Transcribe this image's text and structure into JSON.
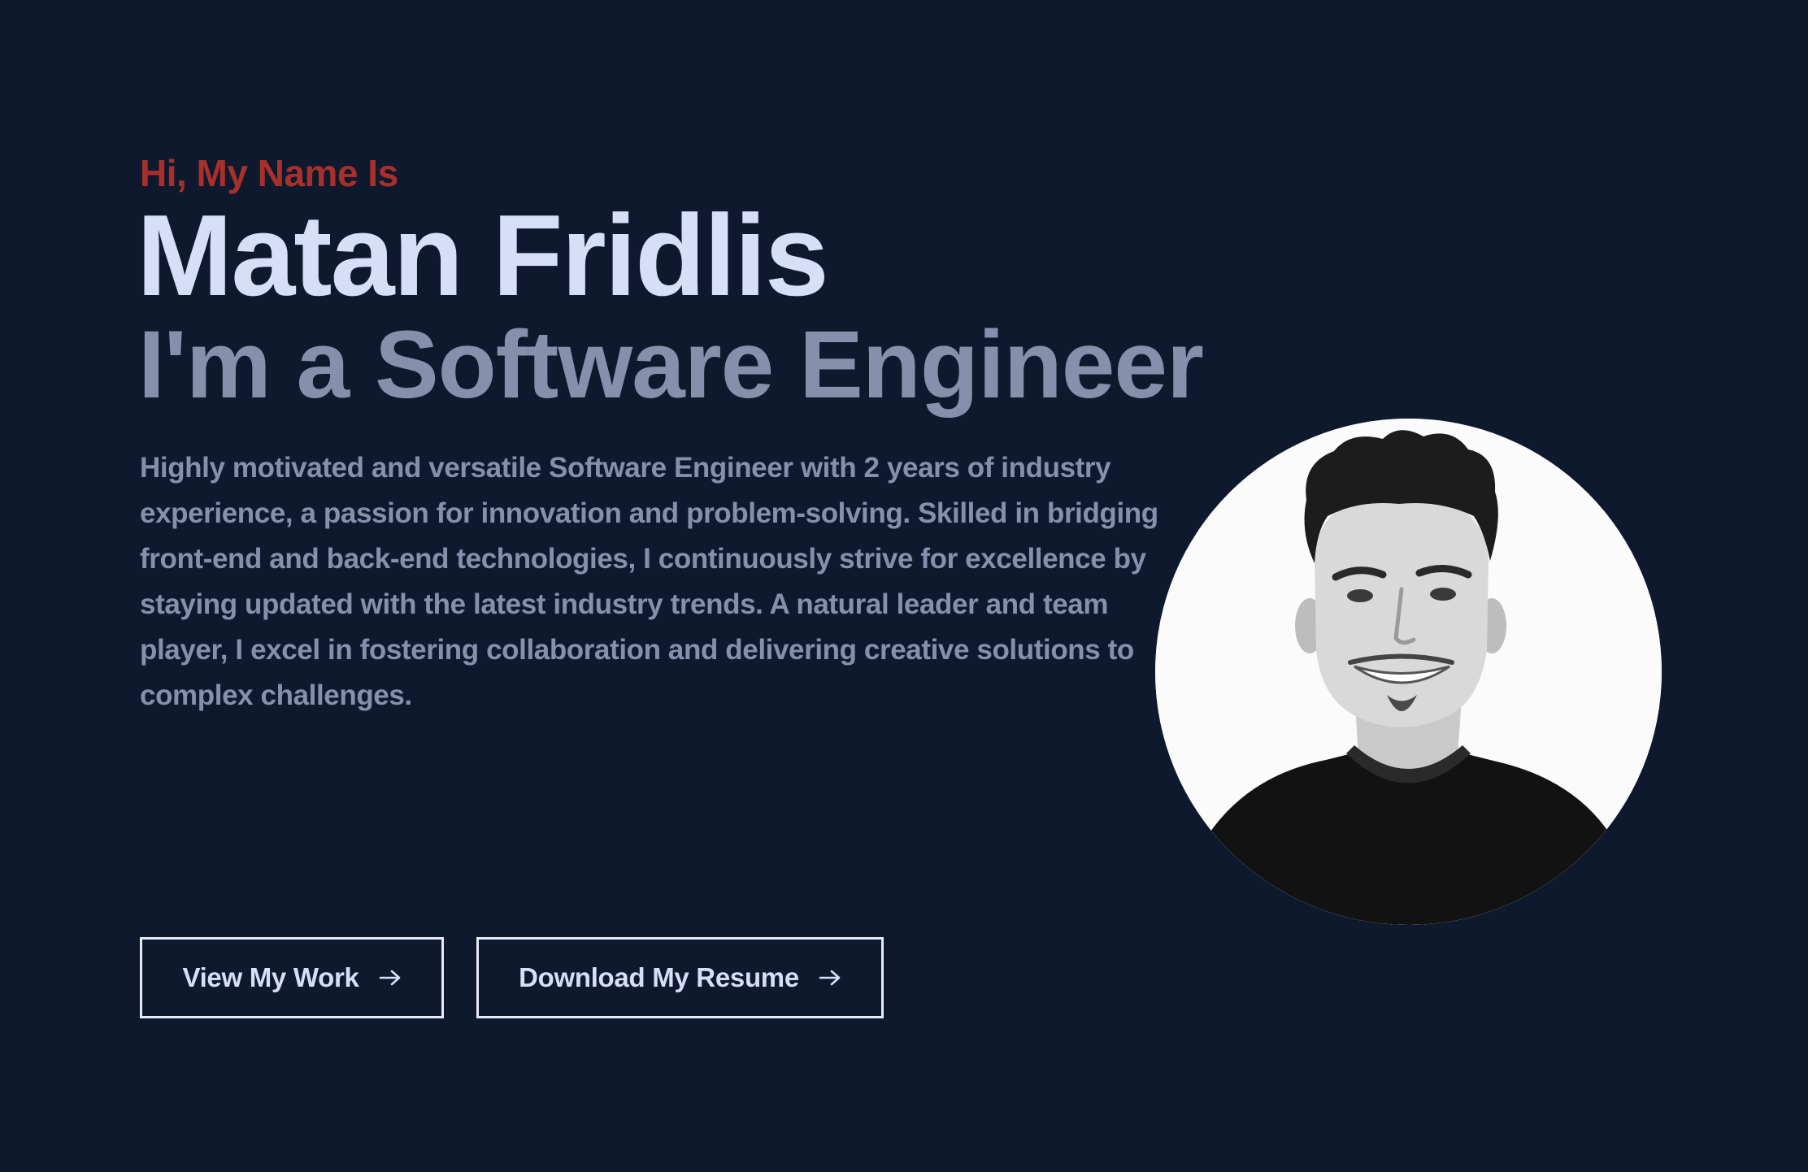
{
  "hero": {
    "greeting": "Hi, My Name Is",
    "name": "Matan Fridlis",
    "role": "I'm a Software Engineer",
    "bio": "Highly motivated and versatile Software Engineer with 2 years of industry experience, a passion for innovation and problem-solving. Skilled in bridging front-end and back-end technologies, I continuously strive for excellence by staying updated with the latest industry trends. A natural leader and team player, I excel in fostering collaboration and delivering creative solutions to complex challenges."
  },
  "actions": {
    "view_work_label": "View My Work",
    "download_resume_label": "Download My Resume",
    "arrow_icon": "arrow-right-icon"
  },
  "colors": {
    "background": "#0f192d",
    "accent": "#a8302a",
    "heading": "#d8def6",
    "muted": "#8790ab",
    "button_border": "#e6eaf7"
  }
}
